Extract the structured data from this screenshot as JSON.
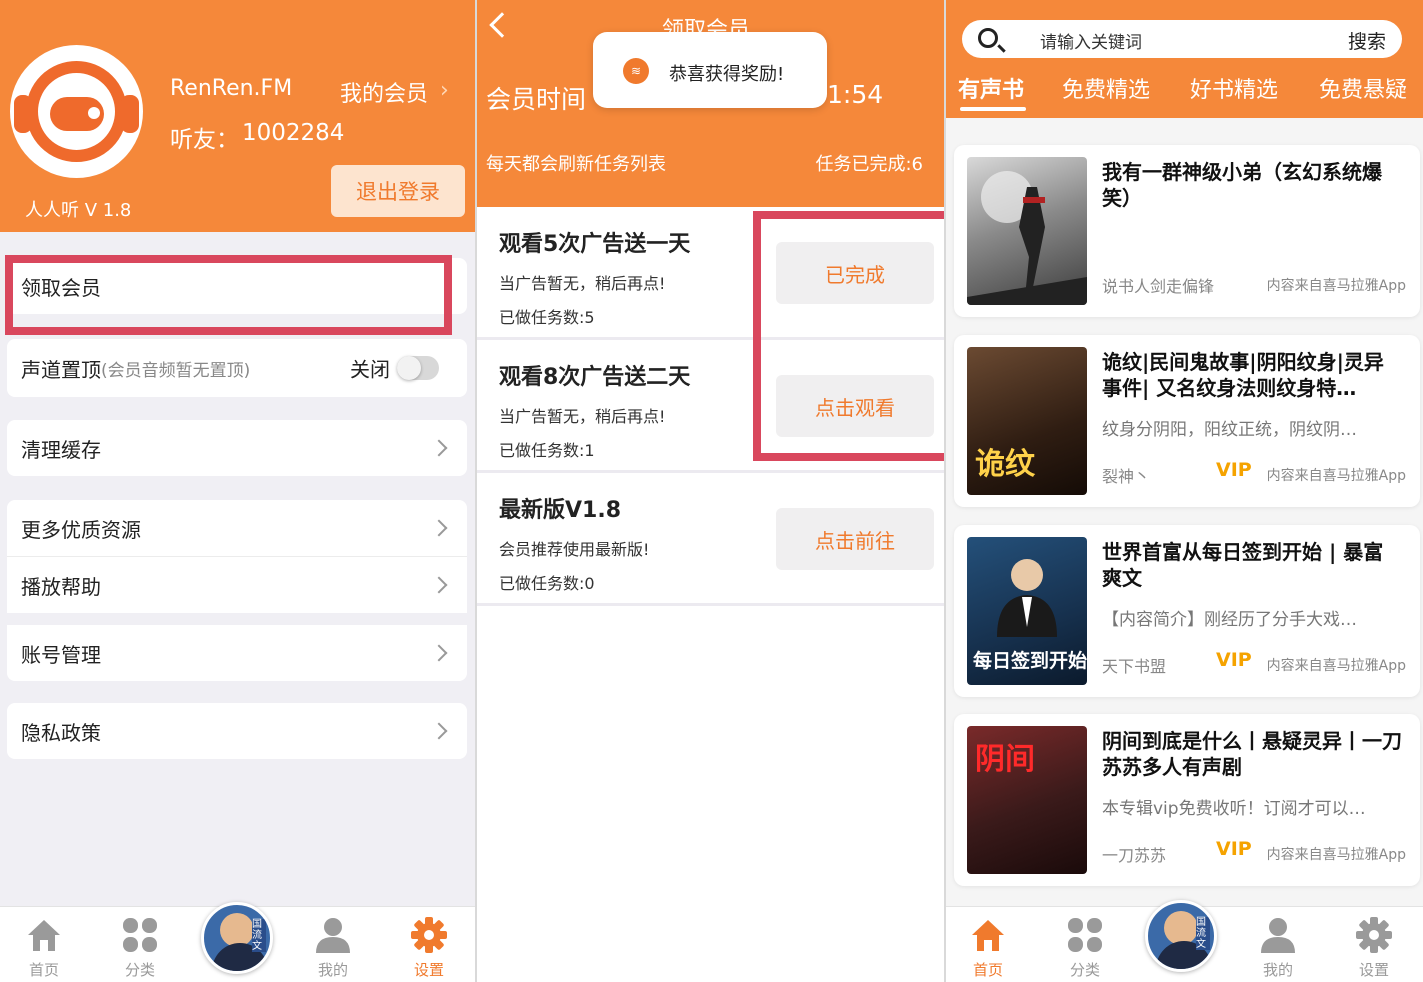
{
  "panel1": {
    "username": "RenRen.FM",
    "member_link": "我的会员",
    "member_arrow": "›",
    "uid_label": "听友：",
    "uid": "1002284",
    "version": "人人听 V 1.8",
    "logout": "退出登录",
    "rows": {
      "claim_member": "领取会员",
      "channel_top": "声道置顶",
      "channel_top_hint": "(会员音频暂无置顶)",
      "channel_top_state": "关闭",
      "clear_cache": "清理缓存",
      "more_resources": "更多优质资源",
      "play_help": "播放帮助",
      "account": "账号管理",
      "privacy": "隐私政策"
    },
    "tabbar": {
      "home": "首页",
      "category": "分类",
      "mine": "我的",
      "settings": "设置",
      "avatar_text": "国流文"
    },
    "colors": {
      "brand": "#f5883a",
      "highlight": "#d9475d"
    }
  },
  "panel2": {
    "title": "领取会员",
    "member_time_label": "会员时间",
    "member_time_value": "1:54",
    "toast": "恭喜获得奖励!",
    "refresh_note": "每天都会刷新任务列表",
    "tasks_done": "任务已完成:6",
    "tasks": [
      {
        "title": "观看5次广告送一天",
        "desc": "当广告暂无，稍后再点!",
        "count": "已做任务数:5",
        "button": "已完成"
      },
      {
        "title": "观看8次广告送二天",
        "desc": "当广告暂无，稍后再点!",
        "count": "已做任务数:1",
        "button": "点击观看"
      },
      {
        "title": "最新版V1.8",
        "desc": "会员推荐使用最新版!",
        "count": "已做任务数:0",
        "button": "点击前往"
      }
    ]
  },
  "panel3": {
    "search_placeholder": "请输入关键词",
    "search_button": "搜索",
    "tabs": [
      "有声书",
      "免费精选",
      "好书精选",
      "免费悬疑"
    ],
    "books": [
      {
        "title": "我有一群神级小弟（玄幻系统爆笑）",
        "desc": "",
        "author": "说书人剑走偏锋",
        "vip": "",
        "source": "内容来自喜马拉雅App",
        "cover_text": ""
      },
      {
        "title": "诡纹|民间鬼故事|阴阳纹身|灵异事件| 又名纹身法则纹身特…",
        "desc": "纹身分阴阳，阳纹正统，阴纹阴…",
        "author": "裂神丶",
        "vip": "VIP",
        "source": "内容来自喜马拉雅App",
        "cover_text": "诡纹"
      },
      {
        "title": "世界首富从每日签到开始 | 暴富爽文",
        "desc": "【内容简介】刚经历了分手大戏…",
        "author": "天下书盟",
        "vip": "VIP",
        "source": "内容来自喜马拉雅App",
        "cover_text": "每日签到开始"
      },
      {
        "title": "阴间到底是什么丨悬疑灵异丨一刀苏苏多人有声剧",
        "desc": "本专辑vip免费收听！订阅才可以…",
        "author": "一刀苏苏",
        "vip": "VIP",
        "source": "内容来自喜马拉雅App",
        "cover_text": "阴间"
      }
    ],
    "tabbar": {
      "home": "首页",
      "category": "分类",
      "mine": "我的",
      "settings": "设置",
      "avatar_text": "国流文"
    }
  }
}
